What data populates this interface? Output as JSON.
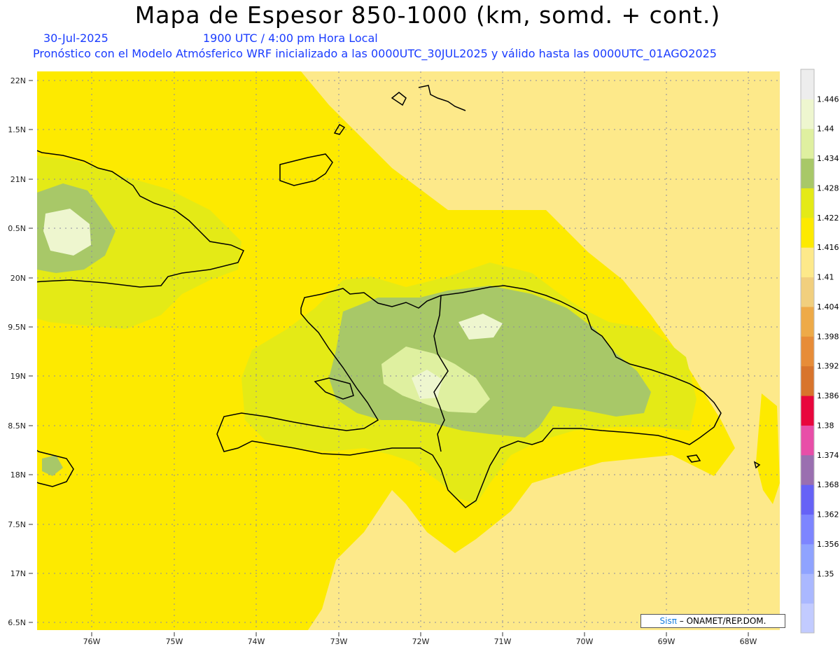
{
  "header": {
    "title": "Mapa de Espesor 850-1000 (km, somd. + cont.)",
    "date": "30-Jul-2025",
    "valid_time": "1900 UTC / 4:00 pm Hora Local",
    "description": "Pronóstico con el Modelo Atmósferico WRF inicializado a las 0000UTC_30JUL2025 y válido hasta las  0000UTC_01AGO2025"
  },
  "credit": {
    "brand": "Sisπ",
    "rest": "– ONAMET/REP.DOM."
  },
  "colors": {
    "c1410": "#fde98a",
    "c1416": "#fdea00",
    "c1422": "#e4ea16",
    "c1428": "#a8c868",
    "c1434": "#dff0a0",
    "c1440": "#eef6cf",
    "c1446": "#ededed",
    "coast": "#000000",
    "grid": "#8a8aa0"
  },
  "chart_data": {
    "type": "heatmap",
    "lat_labels": [
      "22N",
      "1.5N",
      "21N",
      "0.5N",
      "20N",
      "9.5N",
      "19N",
      "8.5N",
      "18N",
      "7.5N",
      "17N",
      "6.5N"
    ],
    "lon_labels": [
      "76W",
      "75W",
      "74W",
      "73W",
      "72W",
      "71W",
      "70W",
      "69W",
      "68W"
    ],
    "colorbar": [
      {
        "value": "",
        "color": "#c2cbff"
      },
      {
        "value": "1.35",
        "color": "#aab8ff"
      },
      {
        "value": "1.356",
        "color": "#8fa3ff"
      },
      {
        "value": "1.362",
        "color": "#7d85ff"
      },
      {
        "value": "1.368",
        "color": "#6662f6"
      },
      {
        "value": "1.374",
        "color": "#9a6fb0"
      },
      {
        "value": "1.38",
        "color": "#e84ea8"
      },
      {
        "value": "1.386",
        "color": "#e8063c"
      },
      {
        "value": "1.392",
        "color": "#d8742c"
      },
      {
        "value": "1.398",
        "color": "#e78c38"
      },
      {
        "value": "1.404",
        "color": "#eeaa48"
      },
      {
        "value": "1.41",
        "color": "#f1cf7e"
      },
      {
        "value": "1.416",
        "color": "#fde98a"
      },
      {
        "value": "1.422",
        "color": "#fdea00"
      },
      {
        "value": "1.428",
        "color": "#e4ea16"
      },
      {
        "value": "1.434",
        "color": "#a8c868"
      },
      {
        "value": "1.44",
        "color": "#dff0a0"
      },
      {
        "value": "1.446",
        "color": "#eef6cf"
      },
      {
        "value": "",
        "color": "#ededed"
      }
    ]
  }
}
